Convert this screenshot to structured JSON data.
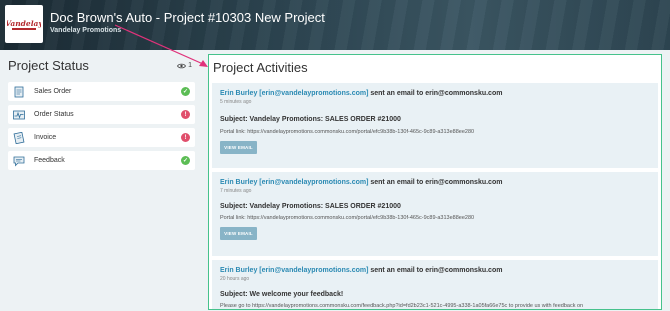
{
  "header": {
    "title": "Doc Brown's Auto - Project #10303 New Project",
    "subtitle": "Vandelay Promotions",
    "logo_icon": "vandelay-logo",
    "logo_text": "Vandelay"
  },
  "left": {
    "title": "Project Status",
    "views_icon": "eye-icon",
    "views_count": "1",
    "items": [
      {
        "label": "Sales Order",
        "icon": "document-icon",
        "status": "complete",
        "badge": "✓",
        "color": "#5cbd55"
      },
      {
        "label": "Order Status",
        "icon": "activity-icon",
        "status": "alert",
        "badge": "!",
        "color": "#e04f6c"
      },
      {
        "label": "Invoice",
        "icon": "invoice-icon",
        "status": "alert",
        "badge": "!",
        "color": "#e04f6c"
      },
      {
        "label": "Feedback",
        "icon": "chat-icon",
        "status": "complete",
        "badge": "✓",
        "color": "#5cbd55"
      }
    ]
  },
  "right": {
    "title": "Project Activities",
    "activities": [
      {
        "who": "Erin Burley [erin@vandelaypromotions.com]",
        "what": " sent an email to erin@commonsku.com",
        "time": "5 minutes ago",
        "subject": "Subject: Vandelay Promotions: SALES ORDER #21000",
        "portal": "Portal link: https://vandelaypromotions.commonsku.com/portal/efc9b38b-130f-465c-9c89-a313e88ee280",
        "button": "VIEW EMAIL"
      },
      {
        "who": "Erin Burley [erin@vandelaypromotions.com]",
        "what": " sent an email to erin@commonsku.com",
        "time": "7 minutes ago",
        "subject": "Subject: Vandelay Promotions: SALES ORDER #21000",
        "portal": "Portal link: https://vandelaypromotions.commonsku.com/portal/efc9b38b-130f-465c-9c89-a313e88ee280",
        "button": "VIEW EMAIL"
      },
      {
        "who": "Erin Burley [erin@vandelaypromotions.com]",
        "what": " sent an email to erin@commonsku.com",
        "time": "20 hours ago",
        "subject": "Subject: We welcome your feedback!",
        "portal": "Please go to https://vandelaypromotions.commonsku.com/feedback.php?id=fd2b23c1-521c-4995-a338-1a05fa66e75c to provide us with feedback on"
      }
    ]
  },
  "colors": {
    "link": "#2b8ab3",
    "panel_border": "#46c28c",
    "annotation_arrow": "#e0327a"
  }
}
